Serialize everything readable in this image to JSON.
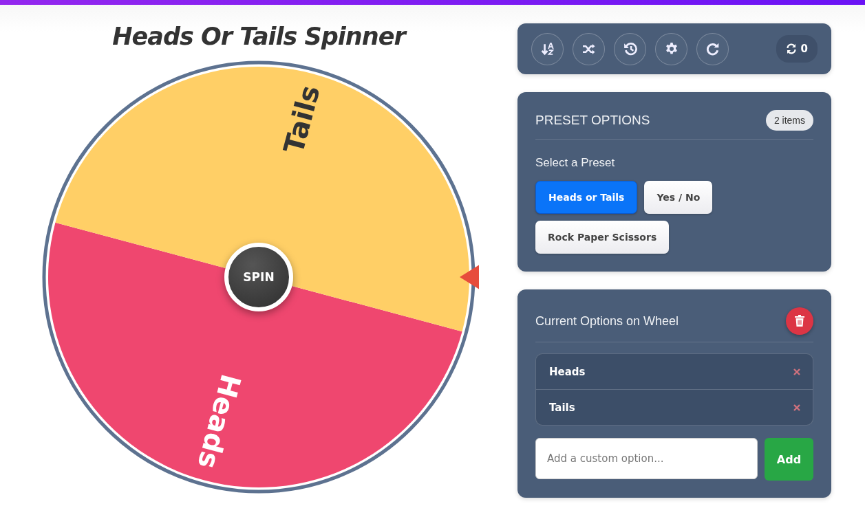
{
  "title": "Heads Or Tails Spinner",
  "wheel": {
    "segments": [
      {
        "label": "Heads",
        "color": "#ef476f"
      },
      {
        "label": "Tails",
        "color": "#ffcf66"
      }
    ],
    "spin_button": "SPIN"
  },
  "toolbar": {
    "spin_count": "0"
  },
  "presets": {
    "title": "PRESET OPTIONS",
    "count_badge": "2 items",
    "subtitle": "Select a Preset",
    "items": [
      {
        "label": "Heads or Tails",
        "selected": true
      },
      {
        "label": "Yes / No",
        "selected": false
      },
      {
        "label": "Rock Paper Scissors",
        "selected": false
      }
    ]
  },
  "current_options": {
    "title": "Current Options on Wheel",
    "items": [
      {
        "label": "Heads"
      },
      {
        "label": "Tails"
      }
    ],
    "input": {
      "placeholder": "Add a custom option..."
    },
    "add_button": "Add"
  }
}
